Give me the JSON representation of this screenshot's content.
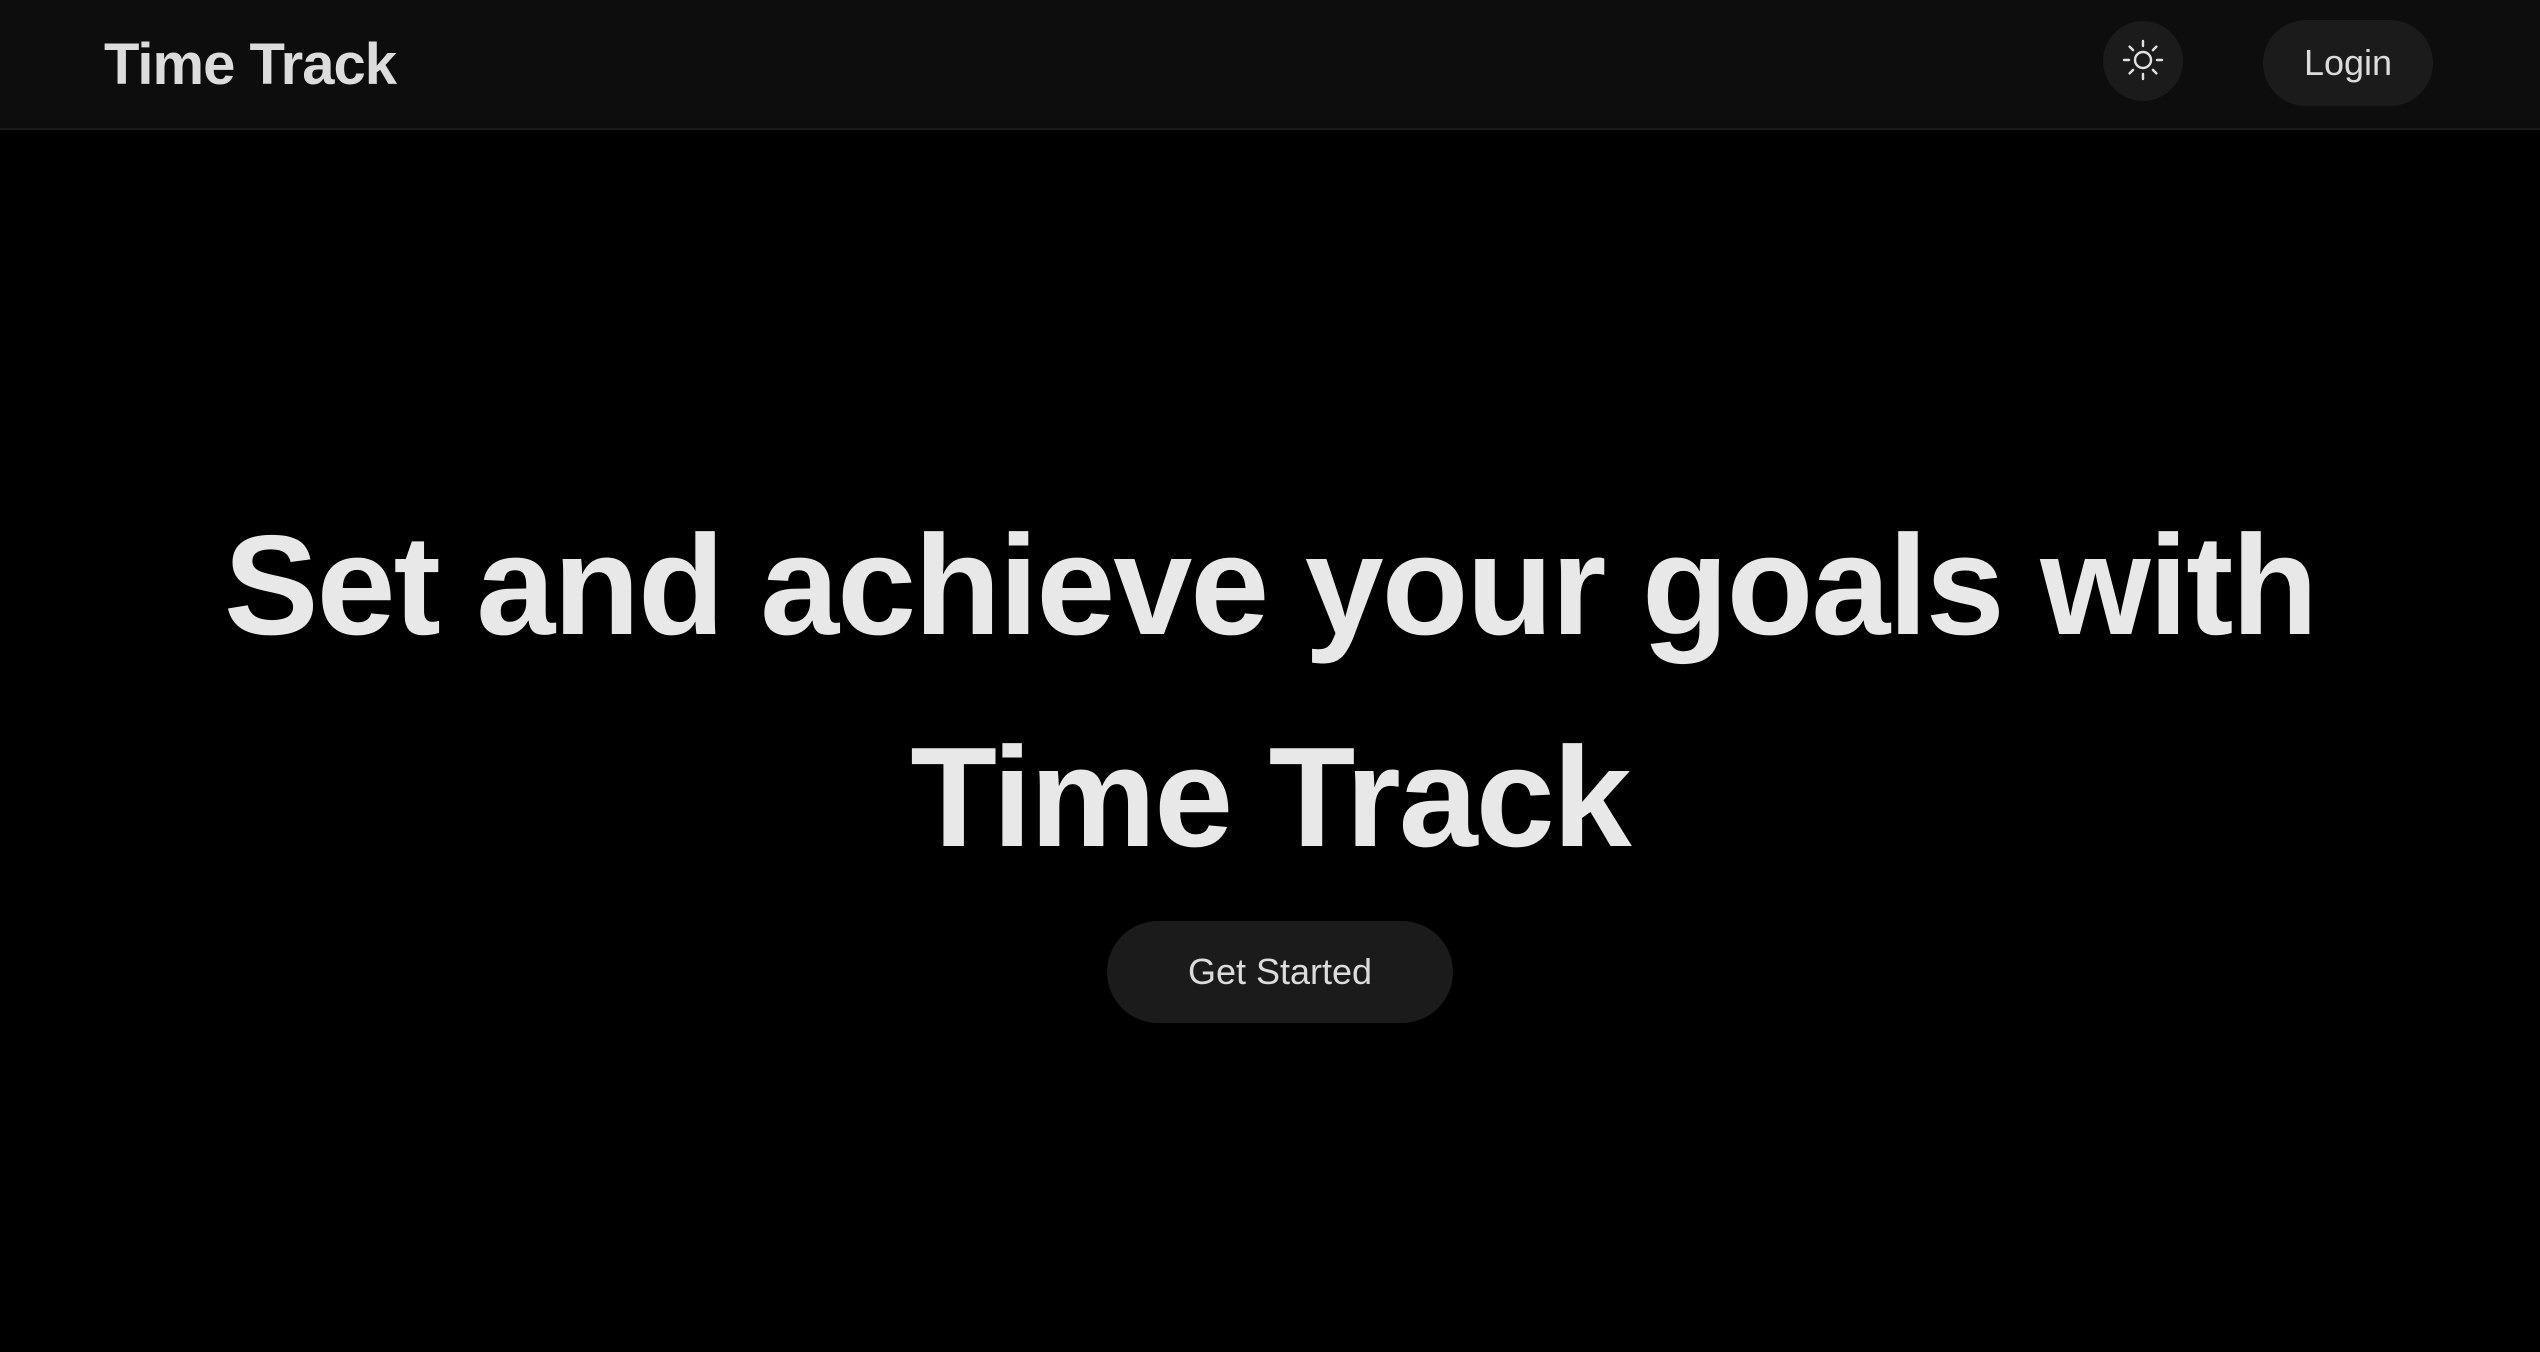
{
  "navbar": {
    "brand": "Time Track",
    "theme_toggle_icon": "sun-icon",
    "login_label": "Login"
  },
  "hero": {
    "title": "Set and achieve your goals with Time Track",
    "cta_label": "Get Started"
  },
  "colors": {
    "background": "#000000",
    "navbar_background": "#0d0d0d",
    "button_background": "#1b1b1b",
    "text": "#e8e8e8"
  }
}
